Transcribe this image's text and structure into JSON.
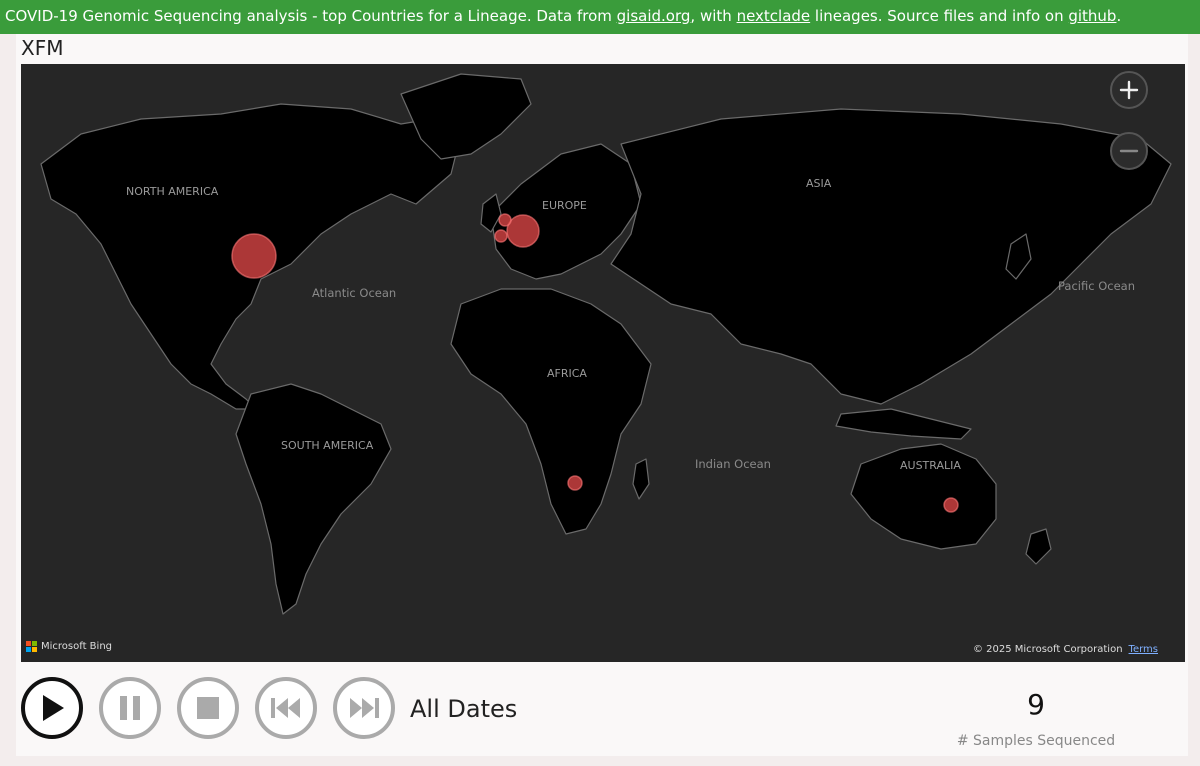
{
  "banner": {
    "text_1": "COVID-19 Genomic Sequencing analysis - top Countries for a Lineage. Data from ",
    "link_1": "gisaid.org",
    "text_2": ", with ",
    "link_2": "nextclade",
    "text_3": " lineages. Source files and info on ",
    "link_3": "github",
    "text_4": "."
  },
  "lineage": "XFM",
  "map": {
    "labels": {
      "north_america": "NORTH AMERICA",
      "south_america": "SOUTH AMERICA",
      "europe": "EUROPE",
      "asia": "ASIA",
      "africa": "AFRICA",
      "australia": "AUSTRALIA",
      "atlantic": "Atlantic Ocean",
      "pacific": "Pacific Ocean",
      "indian": "Indian Ocean"
    },
    "attribution": "Microsoft Bing",
    "copyright": "© 2025 Microsoft Corporation",
    "terms": "Terms",
    "zoom_in_icon": "plus-icon",
    "zoom_out_icon": "minus-icon",
    "bubble_color": "#dc4646"
  },
  "playback": {
    "date_label": "All Dates",
    "icons": [
      "play-icon",
      "pause-icon",
      "stop-icon",
      "skip-back-icon",
      "skip-forward-icon"
    ]
  },
  "card": {
    "value": "9",
    "caption": "# Samples Sequenced"
  }
}
